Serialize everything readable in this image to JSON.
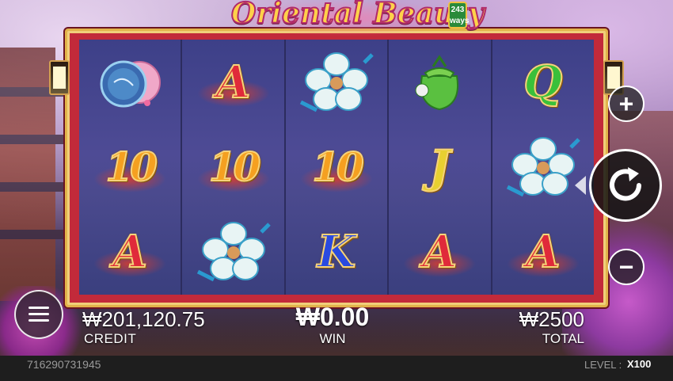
{
  "game": {
    "title": "Oriental Beauty",
    "ways_badge": "243 ways"
  },
  "reels": [
    [
      {
        "symbol": "mirror",
        "icon": "mirror-icon"
      },
      {
        "symbol": "10",
        "label": "10"
      },
      {
        "symbol": "A",
        "label": "A"
      }
    ],
    [
      {
        "symbol": "A",
        "label": "A"
      },
      {
        "symbol": "10",
        "label": "10"
      },
      {
        "symbol": "flower",
        "icon": "plum-blossom-icon"
      }
    ],
    [
      {
        "symbol": "flower",
        "icon": "plum-blossom-icon"
      },
      {
        "symbol": "10",
        "label": "10"
      },
      {
        "symbol": "K",
        "label": "K"
      }
    ],
    [
      {
        "symbol": "pouch",
        "icon": "jade-pouch-icon"
      },
      {
        "symbol": "J",
        "label": "J"
      },
      {
        "symbol": "A",
        "label": "A"
      }
    ],
    [
      {
        "symbol": "Q",
        "label": "Q"
      },
      {
        "symbol": "flower",
        "icon": "plum-blossom-icon"
      },
      {
        "symbol": "A",
        "label": "A"
      }
    ]
  ],
  "hud": {
    "credit_value": "₩201,120.75",
    "credit_label": "CREDIT",
    "win_value": "₩0.00",
    "win_label": "WIN",
    "total_value": "₩2500",
    "total_label": "TOTAL"
  },
  "controls": {
    "plus_icon": "plus-icon",
    "minus_icon": "minus-icon",
    "spin_icon": "refresh-icon",
    "menu_icon": "hamburger-icon",
    "plus_label": "+",
    "minus_label": "−"
  },
  "footer": {
    "round_id": "716290731945",
    "level_label": "LEVEL :",
    "level_value": "X100"
  },
  "colors": {
    "frame": "#c22a3a",
    "frame_border": "#e2b34a",
    "reel_bg": "#4b4a8e",
    "A": "#e02a3a",
    "ten": "#f5a020",
    "J": "#e8d030",
    "Q": "#3ac03a",
    "K": "#2a4ae0"
  }
}
